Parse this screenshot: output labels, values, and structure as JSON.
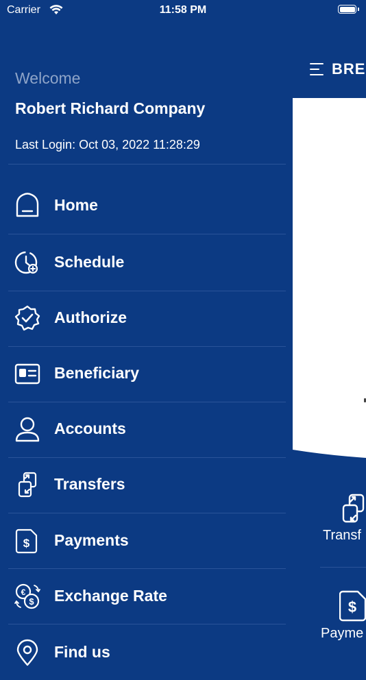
{
  "status_bar": {
    "carrier": "Carrier",
    "time": "11:58 PM",
    "battery_level": 1.0
  },
  "drawer": {
    "welcome": "Welcome",
    "company_name": "Robert Richard Company",
    "last_login": "Last Login: Oct 03, 2022 11:28:29",
    "menu": [
      {
        "label": "Home",
        "icon": "home-icon"
      },
      {
        "label": "Schedule",
        "icon": "schedule-clock-icon"
      },
      {
        "label": "Authorize",
        "icon": "verified-badge-icon"
      },
      {
        "label": "Beneficiary",
        "icon": "id-card-icon"
      },
      {
        "label": "Accounts",
        "icon": "user-icon"
      },
      {
        "label": "Transfers",
        "icon": "transfer-icon"
      },
      {
        "label": "Payments",
        "icon": "payment-document-icon"
      },
      {
        "label": "Exchange Rate",
        "icon": "currency-exchange-icon"
      },
      {
        "label": "Find us",
        "icon": "location-pin-icon"
      }
    ]
  },
  "main": {
    "brand": "BREI",
    "tiles": [
      {
        "label": "Transf",
        "icon": "transfer-icon"
      },
      {
        "label": "Payme",
        "icon": "payment-document-icon"
      }
    ]
  },
  "colors": {
    "background": "#0c3a83",
    "divider": "#2a5399",
    "muted_text": "#8ea4c8",
    "text": "#ffffff"
  }
}
